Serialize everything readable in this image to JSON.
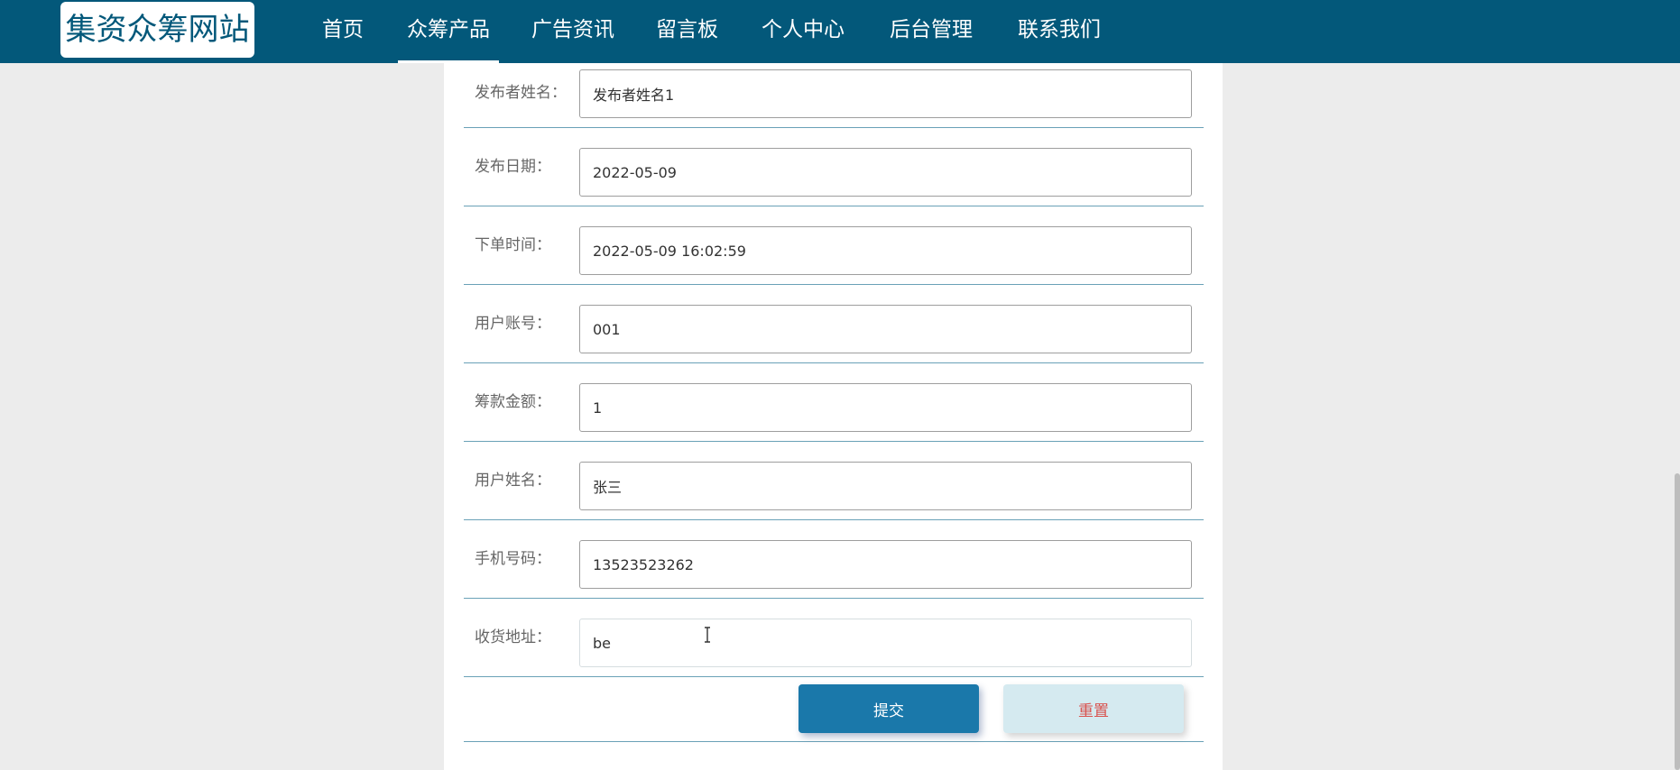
{
  "header": {
    "logo": "集资众筹网站",
    "nav": [
      {
        "label": "首页"
      },
      {
        "label": "众筹产品"
      },
      {
        "label": "广告资讯"
      },
      {
        "label": "留言板"
      },
      {
        "label": "个人中心"
      },
      {
        "label": "后台管理"
      },
      {
        "label": "联系我们"
      }
    ],
    "active_nav": "众筹产品"
  },
  "form": {
    "fields": [
      {
        "label": "发布者姓名：",
        "value": "发布者姓名1"
      },
      {
        "label": "发布日期：",
        "value": "2022-05-09"
      },
      {
        "label": "下单时间：",
        "value": "2022-05-09 16:02:59"
      },
      {
        "label": "用户账号：",
        "value": "001"
      },
      {
        "label": "筹款金额：",
        "value": "1"
      },
      {
        "label": "用户姓名：",
        "value": "张三"
      },
      {
        "label": "手机号码：",
        "value": "13523523262"
      },
      {
        "label": "收货地址：",
        "value": "be"
      }
    ],
    "submit_label": "提交",
    "reset_label": "重置"
  },
  "colors": {
    "navbar": "#03587a",
    "submit": "#1a78aa",
    "reset_bg": "#d5eaf0",
    "reset_text": "#d9534f"
  }
}
